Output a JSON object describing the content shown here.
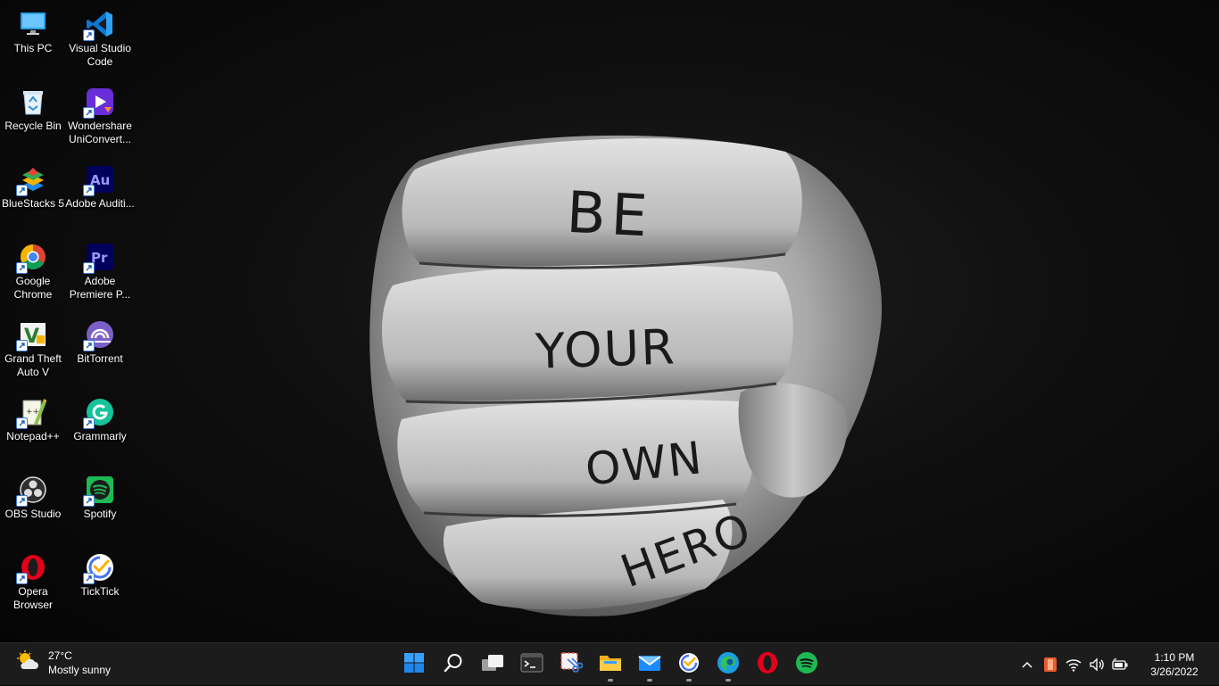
{
  "desktop": {
    "wallpaper_text": [
      "BE",
      "YOUR",
      "OWN",
      "HERO"
    ],
    "icons": [
      {
        "label": "This PC",
        "icon": "monitor-icon"
      },
      {
        "label": "Recycle Bin",
        "icon": "recycle-bin-icon"
      },
      {
        "label": "BlueStacks 5",
        "icon": "bluestacks-icon"
      },
      {
        "label": "Google Chrome",
        "icon": "chrome-icon"
      },
      {
        "label": "Grand Theft Auto V",
        "icon": "gta-icon"
      },
      {
        "label": "Notepad++",
        "icon": "notepadpp-icon"
      },
      {
        "label": "OBS Studio",
        "icon": "obs-icon"
      },
      {
        "label": "Opera Browser",
        "icon": "opera-icon"
      },
      {
        "label": "Visual Studio Code",
        "icon": "vscode-icon"
      },
      {
        "label": "Wondershare UniConvert...",
        "icon": "uniconverter-icon"
      },
      {
        "label": "Adobe Auditi...",
        "icon": "audition-icon"
      },
      {
        "label": "Adobe Premiere P...",
        "icon": "premiere-icon"
      },
      {
        "label": "BitTorrent",
        "icon": "bittorrent-icon"
      },
      {
        "label": "Grammarly",
        "icon": "grammarly-icon"
      },
      {
        "label": "Spotify",
        "icon": "spotify-icon"
      },
      {
        "label": "TickTick",
        "icon": "ticktick-icon"
      }
    ]
  },
  "taskbar": {
    "weather": {
      "temp": "27°C",
      "condition": "Mostly sunny",
      "icon": "partly-sunny-icon"
    },
    "apps": [
      {
        "name": "Start",
        "icon": "windows-start-icon",
        "running": false
      },
      {
        "name": "Search",
        "icon": "search-icon",
        "running": false
      },
      {
        "name": "Task View",
        "icon": "task-view-icon",
        "running": false
      },
      {
        "name": "Terminal",
        "icon": "terminal-icon",
        "running": false
      },
      {
        "name": "Snipping Tool",
        "icon": "snipping-tool-icon",
        "running": false
      },
      {
        "name": "File Explorer",
        "icon": "folder-icon",
        "running": true
      },
      {
        "name": "Mail",
        "icon": "mail-icon",
        "running": true
      },
      {
        "name": "TickTick",
        "icon": "ticktick-icon",
        "running": true
      },
      {
        "name": "Microsoft Edge",
        "icon": "edge-icon",
        "running": true
      },
      {
        "name": "Opera",
        "icon": "opera-icon",
        "running": false
      },
      {
        "name": "Spotify",
        "icon": "spotify-icon",
        "running": false
      }
    ],
    "tray": {
      "icons": [
        "chevron-up-icon",
        "office-icon",
        "wifi-icon",
        "volume-icon",
        "battery-icon"
      ],
      "time": "1:10 PM",
      "date": "3/26/2022"
    }
  },
  "colors": {
    "taskbar_bg": "#1c1c1c",
    "accent_blue": "#0078d4",
    "spotify_green": "#1db954",
    "opera_red": "#e3001b"
  }
}
